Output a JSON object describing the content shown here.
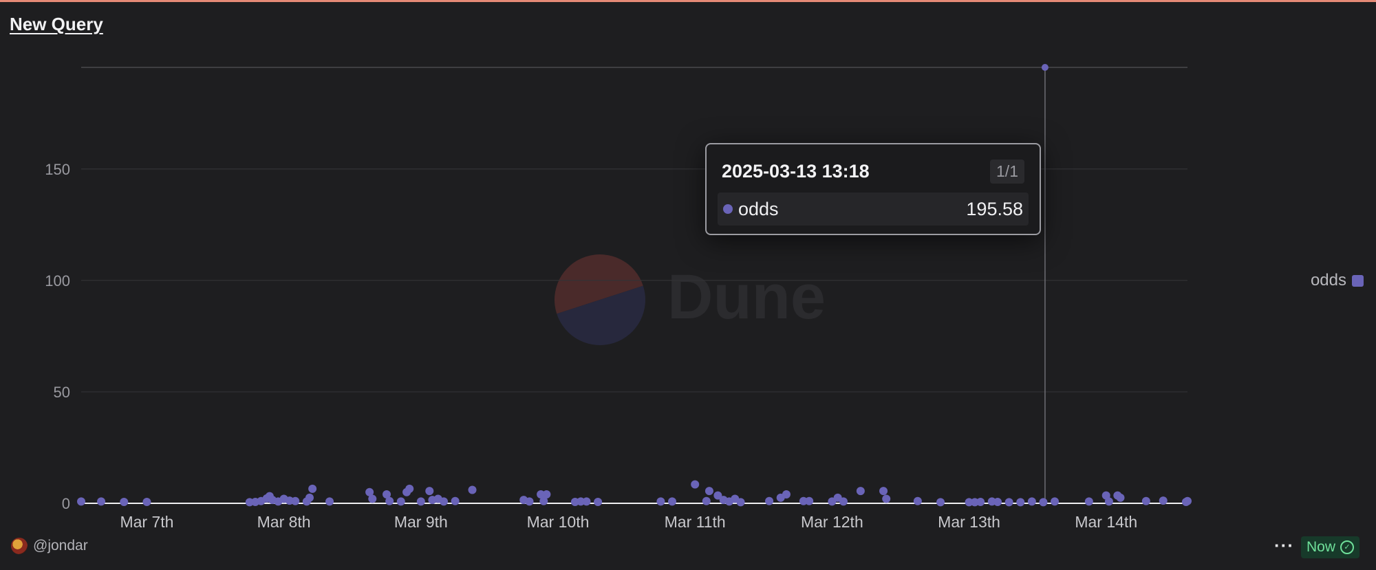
{
  "header": {
    "title": "New Query"
  },
  "watermark": {
    "text": "Dune"
  },
  "legend": {
    "label": "odds",
    "color": "#6a64b8"
  },
  "tooltip": {
    "timestamp": "2025-03-13 13:18",
    "pager": "1/1",
    "series": "odds",
    "value": "195.58"
  },
  "footer": {
    "author": "@jondar",
    "more": "···",
    "status": "Now",
    "status_icon": "check-circle-icon"
  },
  "chart_data": {
    "type": "scatter",
    "title": "New Query",
    "xlabel": "",
    "ylabel": "",
    "ylim": [
      0,
      195.58
    ],
    "xlim": [
      "2025-03-06 12:30",
      "2025-03-14 14:15"
    ],
    "x_ticks": [
      {
        "label": "Mar 7th",
        "at": "2025-03-07 00:00"
      },
      {
        "label": "Mar 8th",
        "at": "2025-03-08 00:00"
      },
      {
        "label": "Mar 9th",
        "at": "2025-03-09 00:00"
      },
      {
        "label": "Mar 10th",
        "at": "2025-03-10 00:00"
      },
      {
        "label": "Mar 11th",
        "at": "2025-03-11 00:00"
      },
      {
        "label": "Mar 12th",
        "at": "2025-03-12 00:00"
      },
      {
        "label": "Mar 13th",
        "at": "2025-03-13 00:00"
      },
      {
        "label": "Mar 14th",
        "at": "2025-03-14 00:00"
      }
    ],
    "y_ticks": [
      0,
      50,
      100,
      150
    ],
    "grid": true,
    "legend_position": "right",
    "hover_marker_x": "2025-03-13 13:18",
    "series": [
      {
        "name": "odds",
        "color": "#6a64b8",
        "points": [
          [
            "2025-03-06 12:30",
            0.8
          ],
          [
            "2025-03-06 16:00",
            0.8
          ],
          [
            "2025-03-06 20:00",
            0.6
          ],
          [
            "2025-03-07 00:00",
            0.6
          ],
          [
            "2025-03-07 18:00",
            0.5
          ],
          [
            "2025-03-07 19:00",
            0.6
          ],
          [
            "2025-03-07 20:00",
            1.0
          ],
          [
            "2025-03-07 21:00",
            2.2
          ],
          [
            "2025-03-07 21:30",
            3.2
          ],
          [
            "2025-03-07 22:00",
            1.5
          ],
          [
            "2025-03-07 23:00",
            0.8
          ],
          [
            "2025-03-08 00:00",
            2.0
          ],
          [
            "2025-03-08 01:00",
            1.2
          ],
          [
            "2025-03-08 02:00",
            1.0
          ],
          [
            "2025-03-08 04:00",
            0.8
          ],
          [
            "2025-03-08 04:30",
            2.5
          ],
          [
            "2025-03-08 05:00",
            6.5
          ],
          [
            "2025-03-08 08:00",
            0.8
          ],
          [
            "2025-03-08 15:00",
            5.0
          ],
          [
            "2025-03-08 15:30",
            2.0
          ],
          [
            "2025-03-08 18:00",
            4.0
          ],
          [
            "2025-03-08 18:30",
            1.0
          ],
          [
            "2025-03-08 20:30",
            0.8
          ],
          [
            "2025-03-08 21:30",
            5.0
          ],
          [
            "2025-03-08 22:00",
            6.5
          ],
          [
            "2025-03-09 00:00",
            0.8
          ],
          [
            "2025-03-09 01:30",
            5.5
          ],
          [
            "2025-03-09 02:00",
            1.5
          ],
          [
            "2025-03-09 03:00",
            2.0
          ],
          [
            "2025-03-09 04:00",
            0.8
          ],
          [
            "2025-03-09 06:00",
            1.0
          ],
          [
            "2025-03-09 09:00",
            6.0
          ],
          [
            "2025-03-09 18:00",
            1.5
          ],
          [
            "2025-03-09 19:00",
            0.8
          ],
          [
            "2025-03-09 21:00",
            4.0
          ],
          [
            "2025-03-09 21:30",
            1.0
          ],
          [
            "2025-03-09 22:00",
            4.0
          ],
          [
            "2025-03-10 03:00",
            0.6
          ],
          [
            "2025-03-10 04:00",
            0.8
          ],
          [
            "2025-03-10 05:00",
            0.8
          ],
          [
            "2025-03-10 07:00",
            0.6
          ],
          [
            "2025-03-10 18:00",
            0.8
          ],
          [
            "2025-03-10 20:00",
            0.8
          ],
          [
            "2025-03-11 00:00",
            8.5
          ],
          [
            "2025-03-11 02:00",
            1.0
          ],
          [
            "2025-03-11 02:30",
            5.5
          ],
          [
            "2025-03-11 04:00",
            3.5
          ],
          [
            "2025-03-11 05:00",
            1.5
          ],
          [
            "2025-03-11 06:00",
            0.8
          ],
          [
            "2025-03-11 07:00",
            2.0
          ],
          [
            "2025-03-11 08:00",
            0.5
          ],
          [
            "2025-03-11 13:00",
            1.0
          ],
          [
            "2025-03-11 15:00",
            2.5
          ],
          [
            "2025-03-11 16:00",
            4.0
          ],
          [
            "2025-03-11 19:00",
            1.0
          ],
          [
            "2025-03-11 20:00",
            1.0
          ],
          [
            "2025-03-12 00:00",
            0.8
          ],
          [
            "2025-03-12 01:00",
            2.5
          ],
          [
            "2025-03-12 02:00",
            0.8
          ],
          [
            "2025-03-12 05:00",
            5.5
          ],
          [
            "2025-03-12 09:00",
            5.5
          ],
          [
            "2025-03-12 09:30",
            2.0
          ],
          [
            "2025-03-12 15:00",
            1.0
          ],
          [
            "2025-03-12 19:00",
            0.5
          ],
          [
            "2025-03-13 00:00",
            0.5
          ],
          [
            "2025-03-13 01:00",
            0.5
          ],
          [
            "2025-03-13 02:00",
            0.6
          ],
          [
            "2025-03-13 04:00",
            0.8
          ],
          [
            "2025-03-13 05:00",
            0.6
          ],
          [
            "2025-03-13 07:00",
            0.5
          ],
          [
            "2025-03-13 09:00",
            0.5
          ],
          [
            "2025-03-13 11:00",
            0.8
          ],
          [
            "2025-03-13 13:00",
            0.5
          ],
          [
            "2025-03-13 15:00",
            0.8
          ],
          [
            "2025-03-13 21:00",
            0.8
          ],
          [
            "2025-03-14 00:00",
            3.5
          ],
          [
            "2025-03-14 00:30",
            0.8
          ],
          [
            "2025-03-14 02:00",
            3.5
          ],
          [
            "2025-03-13 13:18",
            195.58
          ],
          [
            "2025-03-14 02:30",
            2.5
          ],
          [
            "2025-03-14 07:00",
            1.0
          ],
          [
            "2025-03-14 10:00",
            1.2
          ],
          [
            "2025-03-14 14:00",
            0.6
          ],
          [
            "2025-03-14 14:15",
            1.0
          ]
        ]
      }
    ]
  }
}
